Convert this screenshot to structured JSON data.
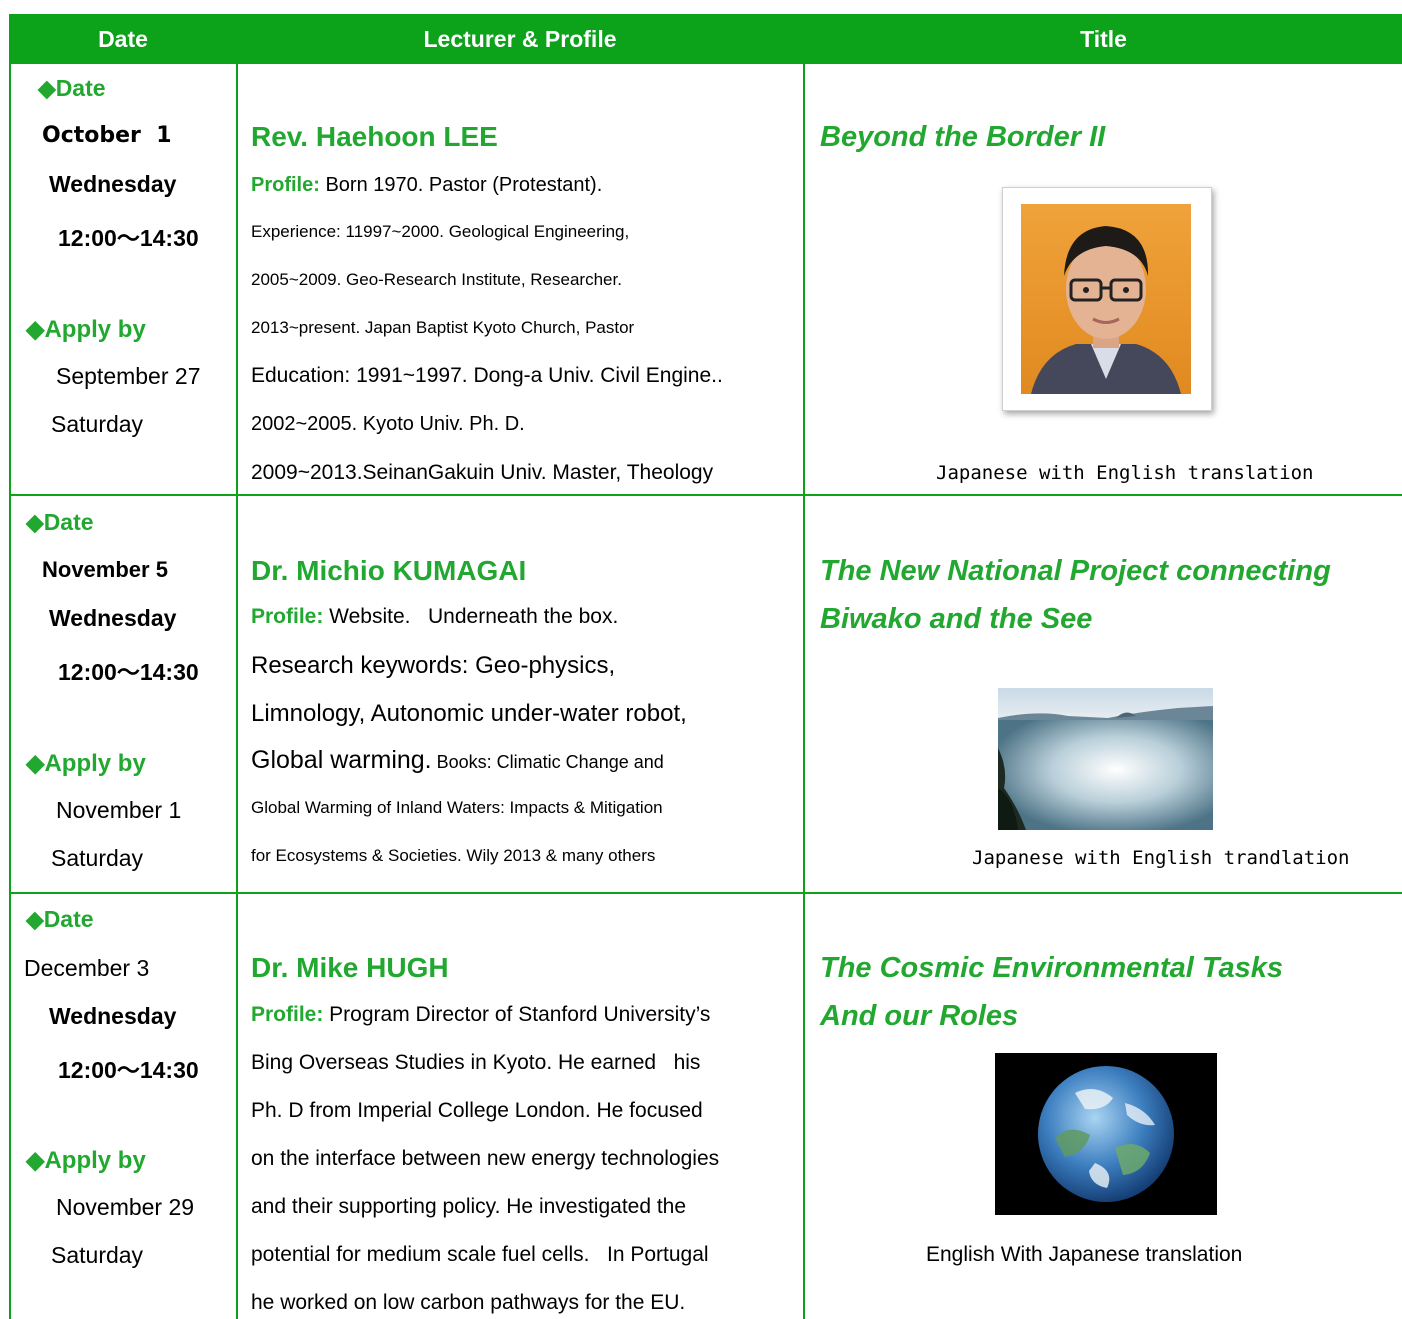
{
  "header": {
    "date": "Date",
    "lecturer": "Lecturer & Profile",
    "title": "Title"
  },
  "rows": [
    {
      "date_label": "◆Date",
      "date": "October  1",
      "weekday": "Wednesday",
      "time": "12:00〜14:30",
      "apply_label": "◆Apply by",
      "apply_date": "September 27",
      "apply_weekday": "Saturday",
      "name": "Rev. Haehoon LEE",
      "profile_label": "Profile:",
      "profile_lines": [
        " Born 1970. Pastor (Protestant).",
        "Experience: 11997~2000. Geological Engineering,",
        "2005~2009. Geo-Research Institute, Researcher.",
        "2013~present. Japan Baptist Kyoto Church, Pastor",
        "Education: 1991~1997. Dong-a Univ. Civil Engine..",
        "2002~2005. Kyoto Univ. Ph. D.",
        "2009~2013.SeinanGakuin Univ. Master, Theology"
      ],
      "title_lines": [
        "Beyond the Border II"
      ],
      "caption": "Japanese  with English translation"
    },
    {
      "date_label": "◆Date",
      "date": "November 5",
      "weekday": "Wednesday",
      "time": "12:00〜14:30",
      "apply_label": "◆Apply by",
      "apply_date": "November 1",
      "apply_weekday": "Saturday",
      "name": "Dr. Michio KUMAGAI",
      "profile_label": "Profile:",
      "profile_lines": [
        " Website.   Underneath the box.",
        "Research keywords: Geo-physics,",
        "Limnology, Autonomic under-water robot,",
        "Global warming.",
        " Books: Climatic Change and",
        "Global Warming of Inland Waters: Impacts & Mitigation",
        "for Ecosystems & Societies. Wily 2013 & many others"
      ],
      "title_lines": [
        "The New National Project connecting",
        "Biwako and the See"
      ],
      "caption": "Japanese  with English trandlation"
    },
    {
      "date_label": "◆Date",
      "date": "December 3",
      "weekday": "Wednesday",
      "time": "12:00〜14:30",
      "apply_label": "◆Apply by",
      "apply_date": "November 29",
      "apply_weekday": "Saturday",
      "name": "Dr. Mike HUGH",
      "profile_label": "Profile:",
      "profile_lines": [
        " Program Director of Stanford University’s",
        "Bing Overseas Studies in Kyoto. He earned   his",
        "Ph. D from Imperial College London. He focused",
        "on the interface between new energy technologies",
        "and their supporting policy. He investigated the",
        "potential for medium scale fuel cells.   In Portugal",
        "he worked on low carbon pathways for the EU."
      ],
      "title_lines": [
        "The Cosmic Environmental Tasks",
        "And our Roles"
      ],
      "caption": "English With Japanese translation"
    }
  ],
  "colors": {
    "accent": "#0ca21a",
    "text_green": "#22a830"
  }
}
